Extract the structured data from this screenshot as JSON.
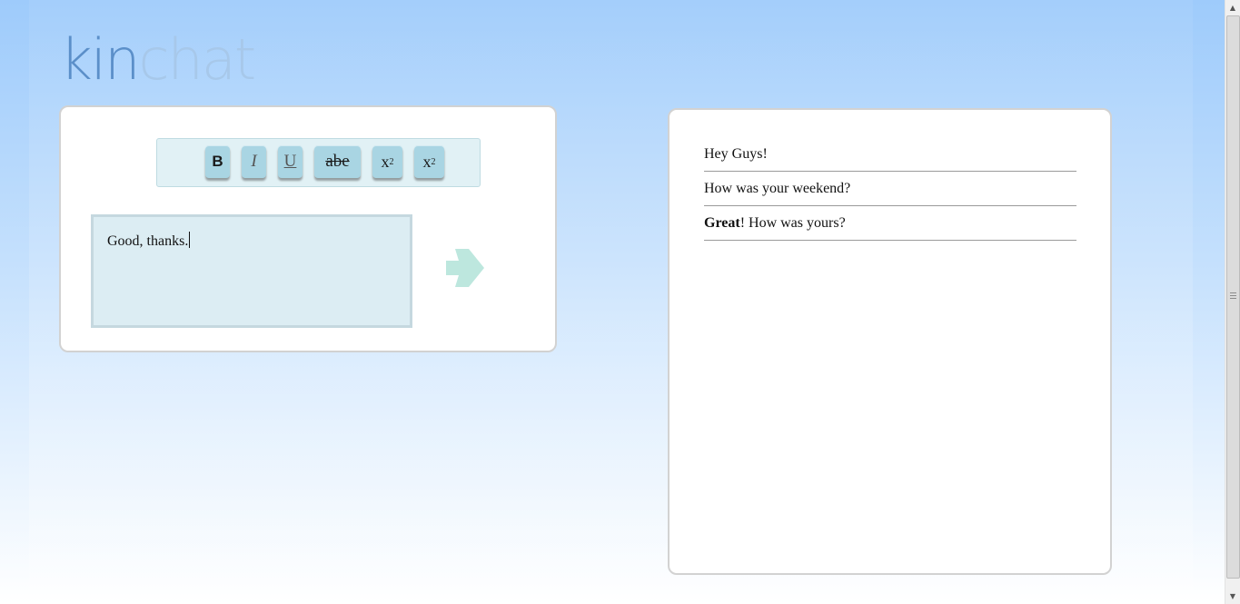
{
  "app": {
    "logo_part1": "kin",
    "logo_part2": "chat"
  },
  "composer": {
    "toolbar": [
      {
        "id": "bold",
        "label": "B"
      },
      {
        "id": "italic",
        "label": "I"
      },
      {
        "id": "underline",
        "label": "U"
      },
      {
        "id": "strikethrough",
        "label": "abe"
      },
      {
        "id": "subscript",
        "label": "x",
        "mark": "2"
      },
      {
        "id": "superscript",
        "label": "x",
        "mark": "2"
      }
    ],
    "input_value": "Good, thanks.",
    "send_icon": "arrow-right-icon",
    "send_color": "#bde7de"
  },
  "chat": {
    "messages": [
      {
        "text": "Hey Guys!"
      },
      {
        "text": "How was your weekend?"
      },
      {
        "bold": "Great",
        "text": "! How was yours?"
      }
    ]
  },
  "colors": {
    "logo_kin": "#5b8fc9",
    "logo_chat": "#a7c8ea",
    "button_bg": "#a9d5e3",
    "toolbar_bg": "#e1f1f5",
    "input_bg": "#dcedf3"
  }
}
